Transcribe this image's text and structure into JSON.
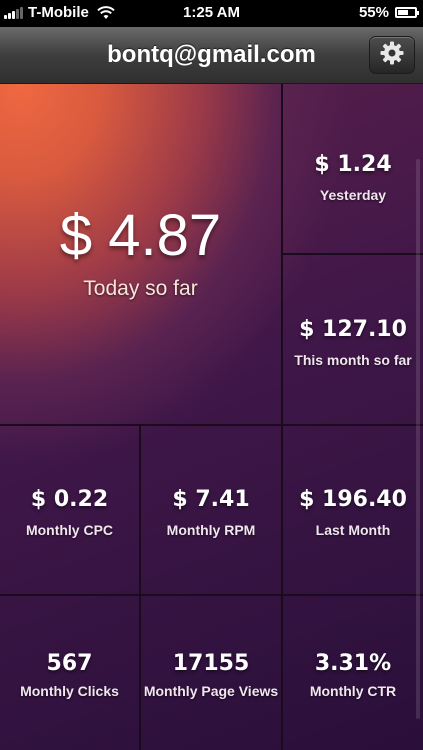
{
  "status_bar": {
    "carrier": "T-Mobile",
    "time": "1:25 AM",
    "battery": "55%",
    "battery_level": 0.55,
    "icons": [
      "signal-icon",
      "wifi-icon",
      "battery-icon"
    ]
  },
  "nav": {
    "title": "bontq@gmail.com",
    "settings_icon": "gear-icon"
  },
  "tiles": {
    "today": {
      "value": "$ 4.87",
      "label": "Today so far"
    },
    "yesterday": {
      "value": "$ 1.24",
      "label": "Yesterday"
    },
    "this_month": {
      "value": "$ 127.10",
      "label": "This month so far"
    },
    "monthly_cpc": {
      "value": "$ 0.22",
      "label": "Monthly CPC"
    },
    "monthly_rpm": {
      "value": "$ 7.41",
      "label": "Monthly RPM"
    },
    "last_month": {
      "value": "$ 196.40",
      "label": "Last Month"
    },
    "monthly_clicks": {
      "value": "567",
      "label": "Monthly Clicks"
    },
    "monthly_page_views": {
      "value": "17155",
      "label": "Monthly Page Views"
    },
    "monthly_ctr": {
      "value": "3.31%",
      "label": "Monthly CTR"
    }
  },
  "colors": {
    "accent_orange": "#f06840",
    "deep_purple": "#2a0f3a",
    "grid_line": "#1a0c1c"
  }
}
